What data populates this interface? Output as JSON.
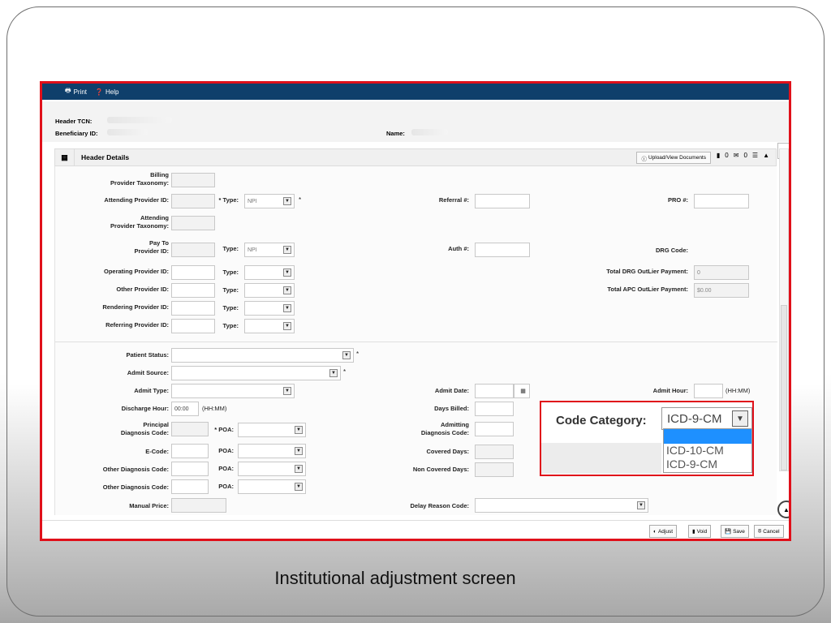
{
  "toolbar": {
    "print_label": "Print",
    "help_label": "Help"
  },
  "header_info": {
    "tcn_label": "Header TCN:",
    "beneficiary_label": "Beneficiary ID:",
    "name_label": "Name:"
  },
  "panel": {
    "title": "Header Details",
    "upload_label": "Upload/View Documents",
    "count1": "0",
    "count2": "0"
  },
  "left_fields": {
    "billing_taxonomy": [
      "Billing",
      "Provider Taxonomy:"
    ],
    "attending_id": "Attending Provider ID:",
    "type_label": "Type:",
    "npi": "NPI",
    "attending_taxonomy": [
      "Attending",
      "Provider Taxonomy:"
    ],
    "pay_to": [
      "Pay To",
      "Provider ID:"
    ],
    "operating_id": "Operating Provider ID:",
    "other_id": "Other Provider ID:",
    "rendering_id": "Rendering Provider ID:",
    "referring_id": "Referring Provider ID:"
  },
  "mid_fields": {
    "referral": "Referral #:",
    "auth": "Auth #:"
  },
  "right_fields": {
    "pro": "PRO #:",
    "drg": "DRG Code:",
    "drg_outlier": "Total DRG OutLier Payment:",
    "drg_outlier_value": "0",
    "apc_outlier": "Total APC OutLier Payment:",
    "apc_outlier_value": "$0.00"
  },
  "lower_fields": {
    "patient_status": "Patient Status:",
    "admit_source": "Admit Source:",
    "admit_type": "Admit Type:",
    "discharge_hour": "Discharge Hour:",
    "discharge_value": "00:00",
    "hhmm": "(HH:MM)",
    "principal_dx": [
      "Principal",
      "Diagnosis Code:"
    ],
    "poa": "POA:",
    "ecode": "E-Code:",
    "other_dx": "Other Diagnosis Code:",
    "manual_price": "Manual Price:",
    "admit_date": "Admit Date:",
    "days_billed": "Days Billed:",
    "admitting_dx": [
      "Admitting",
      "Diagnosis Code:"
    ],
    "covered_days": "Covered Days:",
    "non_covered_days": "Non Covered Days:",
    "delay_reason": "Delay Reason Code:",
    "admit_hour": "Admit Hour:"
  },
  "actions": {
    "adjust": "Adjust",
    "void": "Void",
    "save": "Save",
    "cancel": "Cancel"
  },
  "zoom": {
    "label": "Code Category:",
    "selected": "ICD-9-CM",
    "options": [
      "",
      "ICD-10-CM",
      "ICD-9-CM"
    ]
  },
  "caption": "Institutional adjustment screen"
}
